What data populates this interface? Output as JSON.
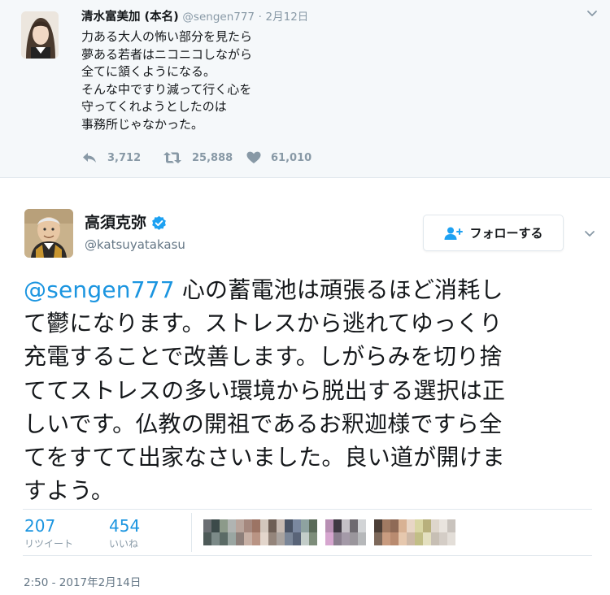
{
  "parent_tweet": {
    "name": "清水富美加 (本名)",
    "handle": "@sengen777",
    "separator": "·",
    "date": "2月12日",
    "lines": [
      "力ある大人の怖い部分を見たら",
      "夢ある若者はニコニコしながら",
      "全てに頷くようになる。",
      "そんな中ですり減って行く心を",
      "守ってくれようとしたのは",
      "事務所じゃなかった。"
    ],
    "actions": {
      "reply_count": "3,712",
      "retweet_count": "25,888",
      "like_count": "61,010"
    },
    "icons": [
      "reply-icon",
      "retweet-icon",
      "heart-icon",
      "chevron-down-icon"
    ]
  },
  "main_tweet": {
    "name": "高須克弥",
    "handle": "@katsuyatakasu",
    "follow_label": "フォローする",
    "verified_icon": "verified-badge-icon",
    "mention": "@sengen777",
    "lines": [
      " 心の蓄電池は頑張るほど消耗し",
      "て鬱になります。ストレスから逃れてゆっくり",
      "充電することで改善します。しがらみを切り捨",
      "ててストレスの多い環境から脱出する選択は正",
      "しいです。仏教の開祖であるお釈迦様ですら全",
      "てをすてて出家なさいました。良い道が開けま",
      "すよう。"
    ],
    "stats": {
      "retweets": "207",
      "retweets_label": "リツイート",
      "likes": "454",
      "likes_label": "いいね"
    },
    "timestamp": "2:50 - 2017年2月14日"
  },
  "colors": {
    "link_blue": "#1b95e0",
    "verified_blue": "#1da1f2",
    "muted": "#8899a6",
    "parent_bg": "#f5f8fa"
  }
}
